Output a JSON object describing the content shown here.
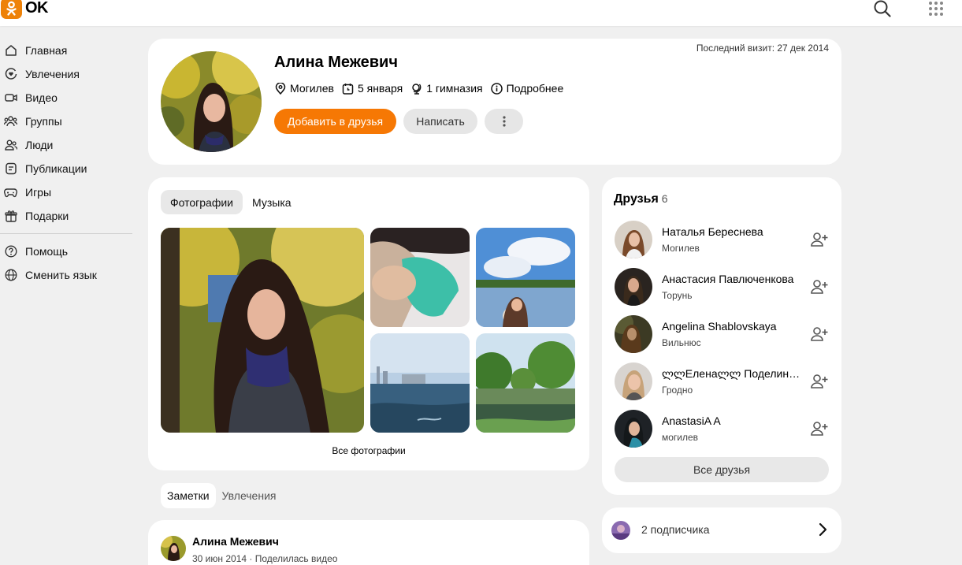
{
  "header": {
    "logo_text": "OK",
    "brand_color": "#ee8208"
  },
  "nav": {
    "items": [
      {
        "label": "Главная",
        "icon": "home-icon"
      },
      {
        "label": "Увлечения",
        "icon": "hobbies-icon"
      },
      {
        "label": "Видео",
        "icon": "video-icon"
      },
      {
        "label": "Группы",
        "icon": "groups-icon"
      },
      {
        "label": "Люди",
        "icon": "people-icon"
      },
      {
        "label": "Публикации",
        "icon": "publications-icon"
      },
      {
        "label": "Игры",
        "icon": "games-icon"
      },
      {
        "label": "Подарки",
        "icon": "gifts-icon"
      }
    ],
    "secondary": [
      {
        "label": "Помощь",
        "icon": "help-icon"
      },
      {
        "label": "Сменить язык",
        "icon": "globe-icon"
      }
    ]
  },
  "profile": {
    "name": "Алина Межевич",
    "last_visit": "Последний визит: 27 дек 2014",
    "city": "Могилев",
    "birthday": "5 января",
    "school": "1 гимназия",
    "more": "Подробнее",
    "add_friend": "Добавить в друзья",
    "write": "Написать"
  },
  "media": {
    "tabs": [
      "Фотографии",
      "Музыка"
    ],
    "all_photos": "Все фотографии"
  },
  "notes": {
    "tabs": [
      "Заметки",
      "Увлечения"
    ]
  },
  "post": {
    "author": "Алина Межевич",
    "date": "30 июн 2014",
    "action": "Поделилась видео"
  },
  "friends": {
    "title": "Друзья",
    "count": "6",
    "list": [
      {
        "name": "Наталья Береснева",
        "city": "Могилев"
      },
      {
        "name": "Анастасия Павлюченкова",
        "city": "Торунь"
      },
      {
        "name": "Angelina Shablovskaya",
        "city": "Вильнюс"
      },
      {
        "name": "ლლЕленаლლ Поделинская",
        "city": "Гродно"
      },
      {
        "name": "AnastasiA A",
        "city": "могилев"
      }
    ],
    "all": "Все друзья"
  },
  "subscribers": {
    "text": "2 подписчика"
  }
}
